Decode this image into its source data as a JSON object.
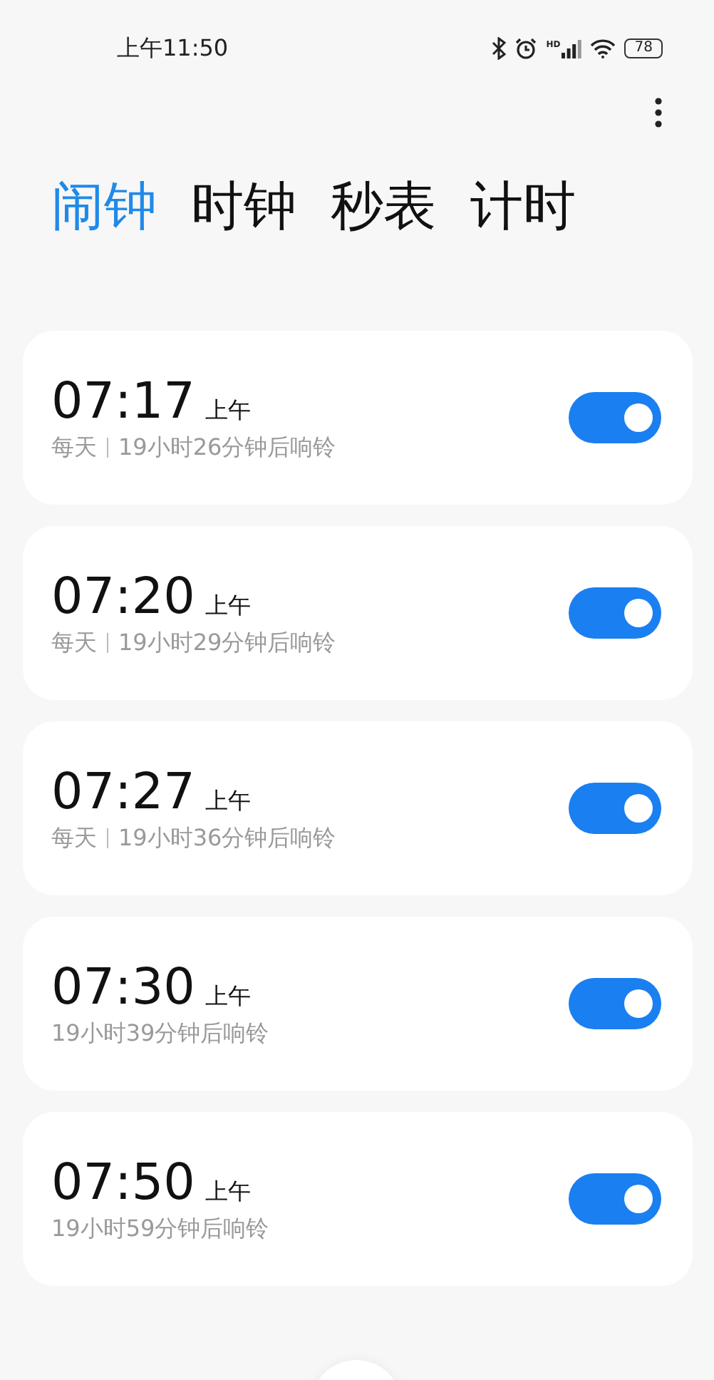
{
  "status_bar": {
    "time": "上午11:50",
    "network_label": "HD",
    "battery": "78"
  },
  "tabs": [
    {
      "label": "闹钟",
      "selected": true
    },
    {
      "label": "时钟",
      "selected": false
    },
    {
      "label": "秒表",
      "selected": false
    },
    {
      "label": "计时",
      "selected": false
    }
  ],
  "alarms": [
    {
      "time": "07:17",
      "period": "上午",
      "repeat": "每天",
      "countdown": "19小时26分钟后响铃",
      "on": true
    },
    {
      "time": "07:20",
      "period": "上午",
      "repeat": "每天",
      "countdown": "19小时29分钟后响铃",
      "on": true
    },
    {
      "time": "07:27",
      "period": "上午",
      "repeat": "每天",
      "countdown": "19小时36分钟后响铃",
      "on": true
    },
    {
      "time": "07:30",
      "period": "上午",
      "countdown": "19小时39分钟后响铃",
      "on": true
    },
    {
      "time": "07:50",
      "period": "上午",
      "countdown": "19小时59分钟后响铃",
      "on": true
    }
  ]
}
